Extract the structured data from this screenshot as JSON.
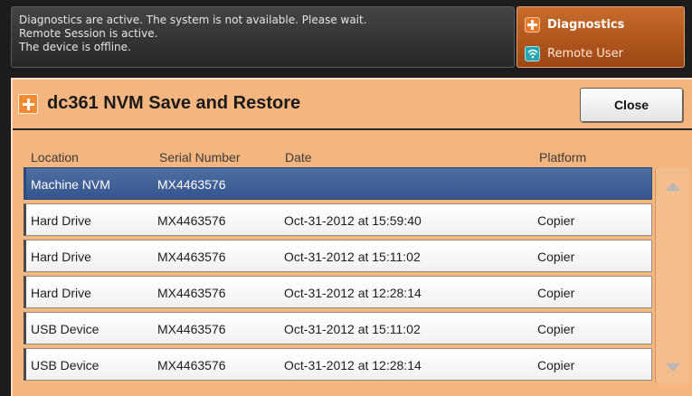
{
  "status": {
    "messages": [
      "Diagnostics are active. The system is not available. Please wait.",
      "Remote Session is active.",
      "The device is offline."
    ],
    "diagnostics_label": "Diagnostics",
    "remote_user_label": "Remote User"
  },
  "window": {
    "title": "dc361 NVM Save and Restore",
    "close_label": "Close"
  },
  "table": {
    "columns": [
      "Location",
      "Serial Number",
      "Date",
      "Platform"
    ],
    "rows": [
      {
        "location": "Machine NVM",
        "serial": "MX4463576",
        "date": "",
        "platform": "",
        "selected": true
      },
      {
        "location": "Hard Drive",
        "serial": "MX4463576",
        "date": "Oct-31-2012 at 15:59:40",
        "platform": "Copier"
      },
      {
        "location": "Hard Drive",
        "serial": "MX4463576",
        "date": "Oct-31-2012 at 15:11:02",
        "platform": "Copier"
      },
      {
        "location": "Hard Drive",
        "serial": "MX4463576",
        "date": "Oct-31-2012 at 12:28:14",
        "platform": "Copier"
      },
      {
        "location": "USB Device",
        "serial": "MX4463576",
        "date": "Oct-31-2012 at 15:11:02",
        "platform": "Copier"
      },
      {
        "location": "USB Device",
        "serial": "MX4463576",
        "date": "Oct-31-2012 at 12:28:14",
        "platform": "Copier"
      }
    ]
  },
  "icons": {
    "diagnostics": "plus-icon",
    "remote_user": "wifi-icon",
    "title": "plus-icon",
    "scroll_up": "triangle-up-icon",
    "scroll_down": "triangle-down-icon"
  },
  "colors": {
    "accent_orange": "#f48b33",
    "panel_background": "#f4b57f",
    "selected_row": "#3f5f97"
  }
}
